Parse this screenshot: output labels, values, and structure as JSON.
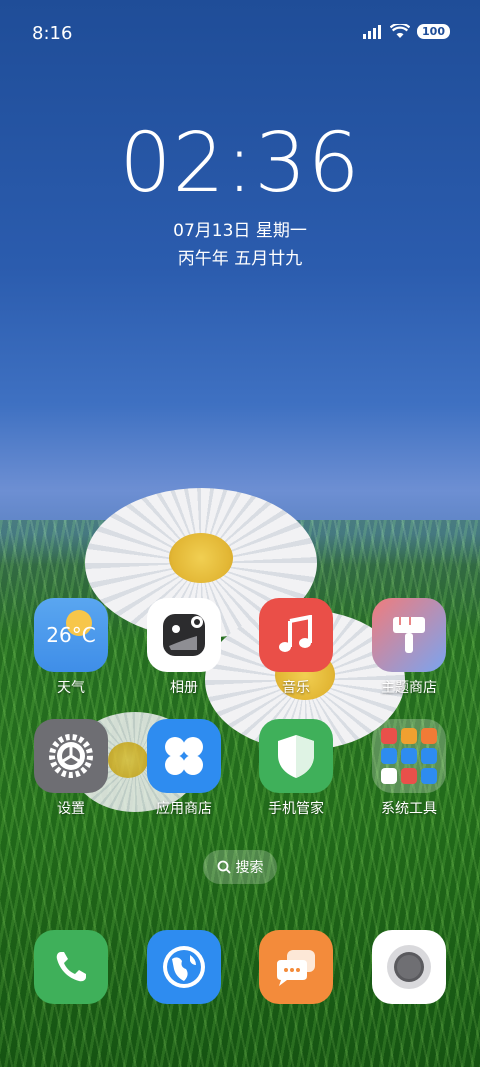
{
  "status_bar": {
    "time": "8:16",
    "battery": "100"
  },
  "lock_clock": {
    "time": "02:36",
    "date": "07月13日 星期一",
    "lunar_date": "丙午年 五月廿九"
  },
  "apps_row1": [
    {
      "label": "天气",
      "temp": "26°C"
    },
    {
      "label": "相册"
    },
    {
      "label": "音乐"
    },
    {
      "label": "主题商店"
    }
  ],
  "apps_row2": [
    {
      "label": "设置"
    },
    {
      "label": "应用商店"
    },
    {
      "label": "手机管家"
    },
    {
      "label": "系统工具"
    }
  ],
  "search": {
    "label": "搜索"
  },
  "dock": [
    "phone-icon",
    "browser-icon",
    "messages-icon",
    "camera-icon"
  ],
  "colors": {
    "sky": "#2b5cae",
    "grass": "#2b7a22",
    "music": "#e9504a",
    "settings": "#6e6e73",
    "store": "#2e8cf0",
    "security": "#3fb05a"
  }
}
